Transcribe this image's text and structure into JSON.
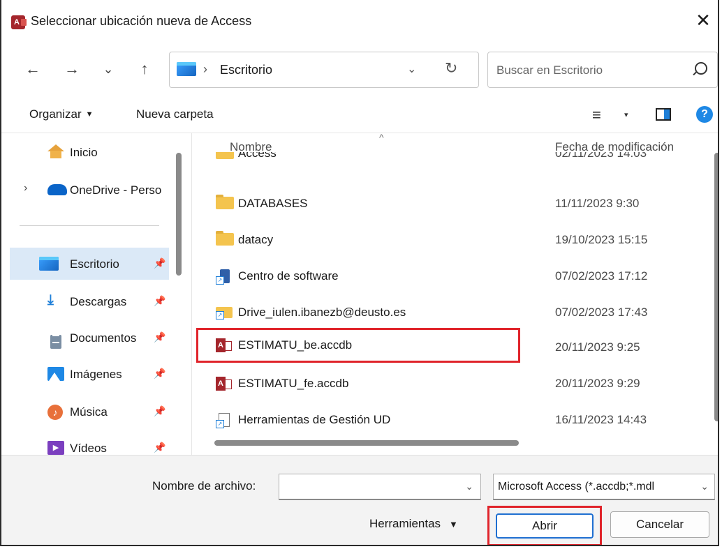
{
  "window": {
    "title": "Seleccionar ubicación nueva de Access",
    "app_icon_letter": "A"
  },
  "nav": {
    "back": "←",
    "forward": "→",
    "recent": "⌄",
    "up": "↑",
    "address": {
      "separator": "›",
      "crumb": "Escritorio",
      "dropdown": "⌄",
      "refresh": "↻"
    },
    "search_placeholder": "Buscar en Escritorio"
  },
  "toolbar": {
    "organize": "Organizar",
    "new_folder": "Nueva carpeta",
    "view_icon": "≡",
    "view_caret": "▾",
    "help": "?"
  },
  "sidebar": {
    "items": [
      {
        "label": "Inicio",
        "icon": "home-icon",
        "pinned": false
      },
      {
        "label": "OneDrive - Perso",
        "icon": "cloud-icon",
        "expandable": true
      },
      {
        "label": "Escritorio",
        "icon": "desktop-folder-icon",
        "pinned": true,
        "selected": true
      },
      {
        "label": "Descargas",
        "icon": "download-icon",
        "pinned": true
      },
      {
        "label": "Documentos",
        "icon": "documents-icon",
        "pinned": true
      },
      {
        "label": "Imágenes",
        "icon": "pictures-icon",
        "pinned": true
      },
      {
        "label": "Música",
        "icon": "music-icon",
        "pinned": true
      },
      {
        "label": "Vídeos",
        "icon": "videos-icon",
        "pinned": true
      }
    ]
  },
  "columns": {
    "name": "Nombre",
    "date": "Fecha de modificación",
    "sort_caret": "^"
  },
  "files": [
    {
      "name": "Access",
      "date": "02/11/2023 14:03",
      "type": "folder"
    },
    {
      "name": "DATABASES",
      "date": "11/11/2023 9:30",
      "type": "folder"
    },
    {
      "name": "datacy",
      "date": "19/10/2023 15:15",
      "type": "folder"
    },
    {
      "name": "Centro de software",
      "date": "07/02/2023 17:12",
      "type": "shortcut-app"
    },
    {
      "name": "Drive_iulen.ibanezb@deusto.es",
      "date": "07/02/2023 17:43",
      "type": "shortcut-folder"
    },
    {
      "name": "ESTIMATU_be.accdb",
      "date": "20/11/2023 9:25",
      "type": "access",
      "highlighted": true
    },
    {
      "name": "ESTIMATU_fe.accdb",
      "date": "20/11/2023 9:29",
      "type": "access"
    },
    {
      "name": "Herramientas de Gestión UD",
      "date": "16/11/2023 14:43",
      "type": "shortcut-file"
    }
  ],
  "footer": {
    "filename_label": "Nombre de archivo:",
    "filename_value": "",
    "filetype_value": "Microsoft Access (*.accdb;*.mdl",
    "tools_label": "Herramientas",
    "open_label": "Abrir",
    "cancel_label": "Cancelar"
  },
  "colors": {
    "accent": "#1f6fd1",
    "highlight_box": "#e0242b",
    "selected_bg": "#dbe9f7"
  }
}
